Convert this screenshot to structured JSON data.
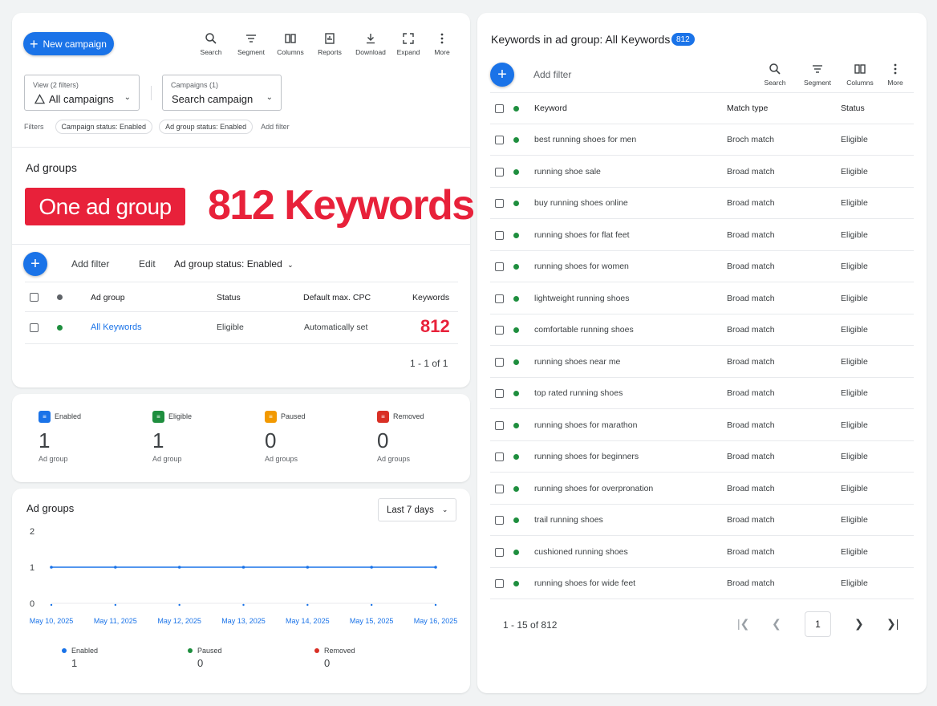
{
  "left": {
    "new_campaign": "New campaign",
    "toolbar": [
      "Search",
      "Segment",
      "Columns",
      "Reports",
      "Download",
      "Expand",
      "More"
    ],
    "view_small": "View (2 filters)",
    "view_value": "All campaigns",
    "campaign_small": "Campaigns (1)",
    "campaign_value": "Search campaign",
    "filters_label": "Filters",
    "chips": [
      "Campaign status: Enabled",
      "Ad group status: Enabled"
    ],
    "add_filter": "Add filter",
    "section_title": "Ad groups",
    "banner": "One ad group",
    "headline": "812 Keywords",
    "action_add_filter": "Add filter",
    "action_edit": "Edit",
    "action_status": "Ad group status: Enabled",
    "table_headers": [
      "Ad group",
      "Status",
      "Default max. CPC",
      "Keywords"
    ],
    "row": {
      "name": "All Keywords",
      "status": "Eligible",
      "cpc": "Automatically set",
      "keywords": "812"
    },
    "pagination": "1 - 1 of 1"
  },
  "stats": [
    {
      "label": "Enabled",
      "value": "1",
      "sub": "Ad group",
      "color": "#1a73e8"
    },
    {
      "label": "Eligible",
      "value": "1",
      "sub": "Ad group",
      "color": "#1e8e3e"
    },
    {
      "label": "Paused",
      "value": "0",
      "sub": "Ad groups",
      "color": "#f29900"
    },
    {
      "label": "Removed",
      "value": "0",
      "sub": "Ad groups",
      "color": "#d93025"
    }
  ],
  "chart_panel": {
    "title": "Ad groups",
    "range": "Last 7 days"
  },
  "chart_data": {
    "type": "line",
    "x": [
      "May 10, 2025",
      "May 11, 2025",
      "May 12, 2025",
      "May 13, 2025",
      "May 14, 2025",
      "May 15, 2025",
      "May 16, 2025"
    ],
    "series": [
      {
        "name": "Enabled",
        "values": [
          1,
          1,
          1,
          1,
          1,
          1,
          1
        ],
        "color": "#1a73e8"
      }
    ],
    "y_ticks": [
      "2",
      "1",
      "0"
    ],
    "ylim": [
      0,
      2
    ],
    "legend": [
      {
        "name": "Enabled",
        "value": "1",
        "color": "#1a73e8"
      },
      {
        "name": "Paused",
        "value": "0",
        "color": "#1e8e3e"
      },
      {
        "name": "Removed",
        "value": "0",
        "color": "#d93025"
      }
    ]
  },
  "right": {
    "title": "Keywords in ad group: All Keywords",
    "count_badge": "812",
    "add_filter": "Add filter",
    "toolbar": [
      "Search",
      "Segment",
      "Columns",
      "More"
    ],
    "headers": [
      "Keyword",
      "Match type",
      "Status"
    ],
    "rows": [
      [
        "best running shoes for men",
        "Broch match",
        "Eligible"
      ],
      [
        "running shoe sale",
        "Broad match",
        "Eligible"
      ],
      [
        "buy running shoes online",
        "Broad match",
        "Eligible"
      ],
      [
        "running shoes for flat feet",
        "Broad match",
        "Eligible"
      ],
      [
        "running shoes for women",
        "Broad match",
        "Eligible"
      ],
      [
        "lightweight running shoes",
        "Broad match",
        "Eligible"
      ],
      [
        "comfortable running shoes",
        "Broad match",
        "Eligible"
      ],
      [
        "running shoes near me",
        "Broad match",
        "Eligible"
      ],
      [
        "top rated running shoes",
        "Broad match",
        "Eligible"
      ],
      [
        "running shoes for marathon",
        "Broad match",
        "Eligible"
      ],
      [
        "running shoes for beginners",
        "Broad match",
        "Eligible"
      ],
      [
        "running shoes for overpronation",
        "Broad match",
        "Eligible"
      ],
      [
        "trail running shoes",
        "Broad match",
        "Eligible"
      ],
      [
        "cushioned running shoes",
        "Broad match",
        "Eligible"
      ],
      [
        "running shoes for wide feet",
        "Broad match",
        "Eligible"
      ]
    ],
    "pagination": "1 - 15 of 812",
    "page": "1"
  }
}
